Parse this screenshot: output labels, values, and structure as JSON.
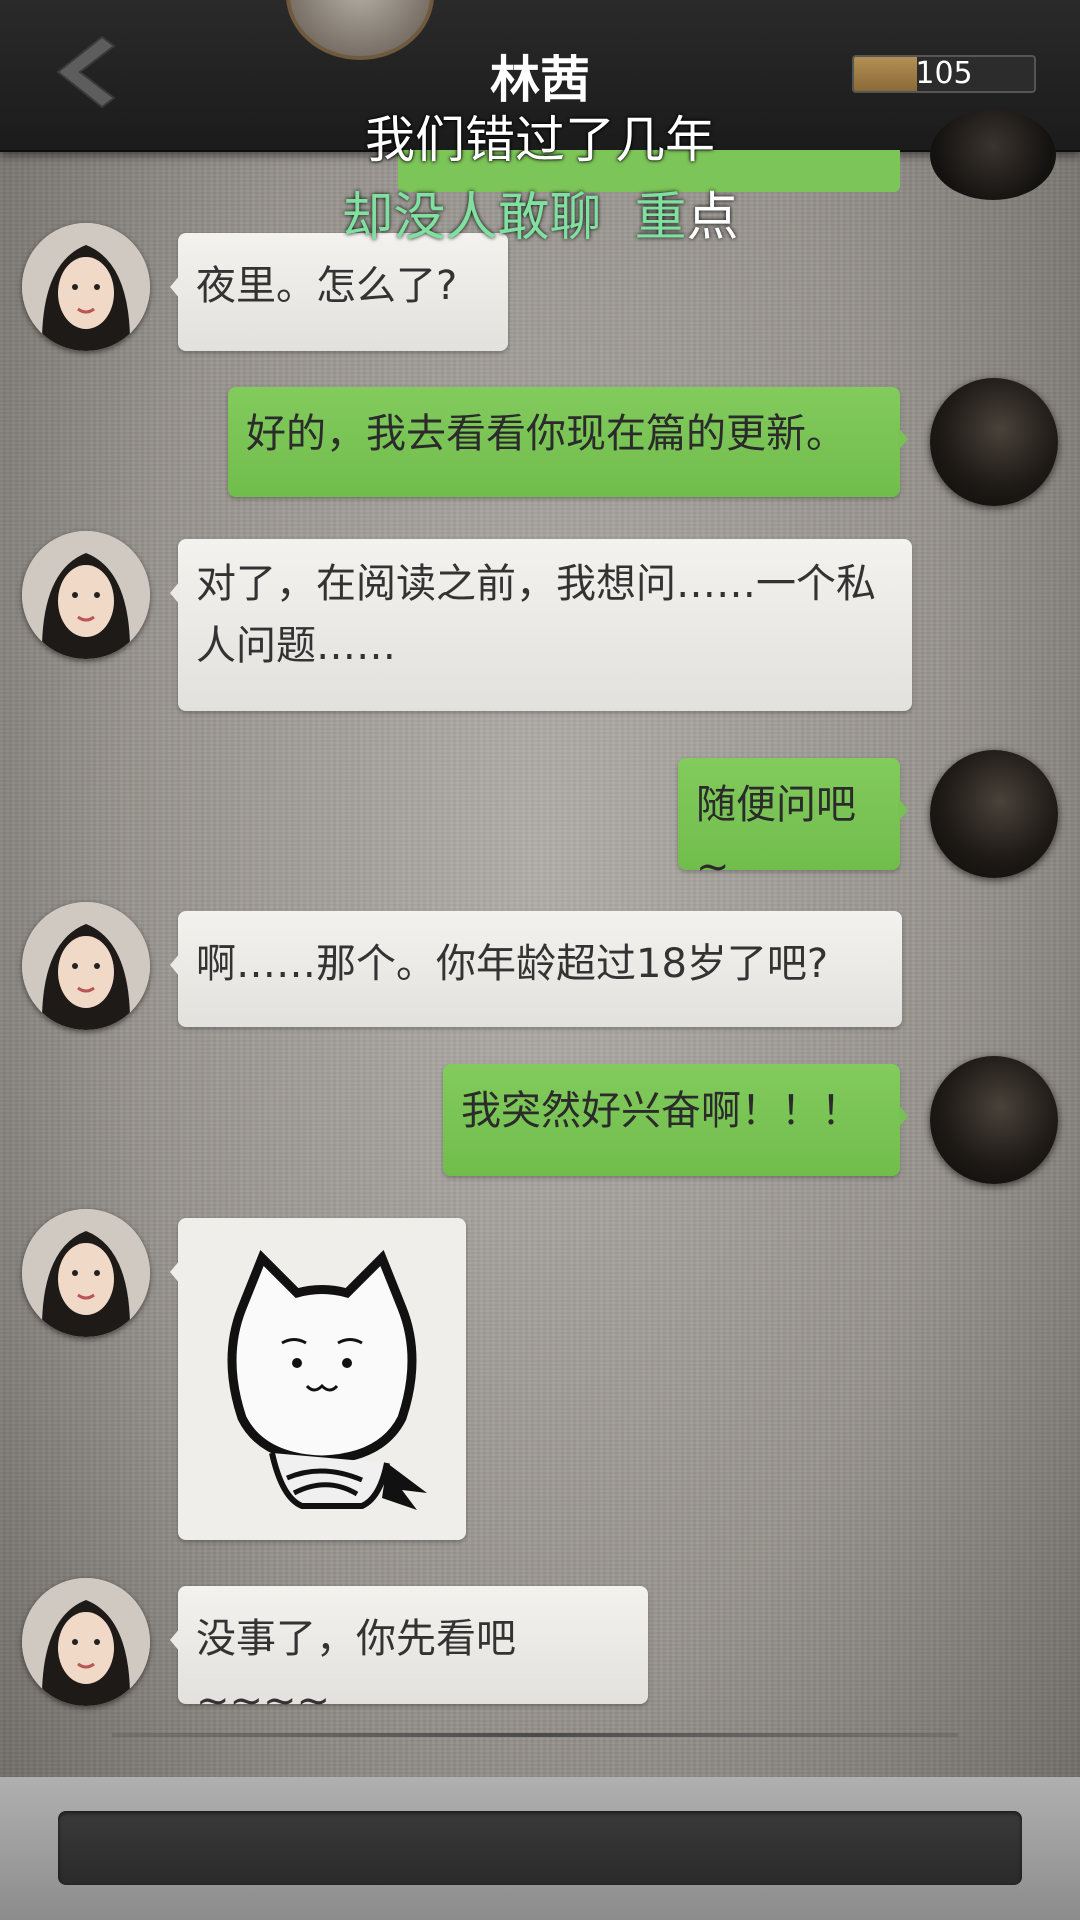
{
  "header": {
    "title": "林茜",
    "coins": "105",
    "coin_fill_fraction": 0.35
  },
  "subtitle": {
    "line1": "我们错过了几年",
    "line2_highlight": "却没人敢聊",
    "line2_rest_green": "重",
    "line2_rest_white": "点"
  },
  "messages": [
    {
      "side": "left",
      "text": "夜里。怎么了?"
    },
    {
      "side": "right",
      "text": "好的，我去看看你现在篇的更新。"
    },
    {
      "side": "left",
      "text": "对了，在阅读之前，我想问……一个私人问题……"
    },
    {
      "side": "right",
      "text": "随便问吧~"
    },
    {
      "side": "left",
      "text": "啊……那个。你年龄超过18岁了吧?"
    },
    {
      "side": "right",
      "text": "我突然好兴奋啊！！！"
    },
    {
      "side": "left",
      "type": "sticker",
      "sticker": "cat-sticker"
    },
    {
      "side": "left",
      "text": "没事了，你先看吧~~~~"
    }
  ],
  "input": {
    "placeholder": ""
  },
  "colors": {
    "green_bubble": "#7cc558",
    "white_bubble": "#eceae6",
    "header": "#222222"
  }
}
